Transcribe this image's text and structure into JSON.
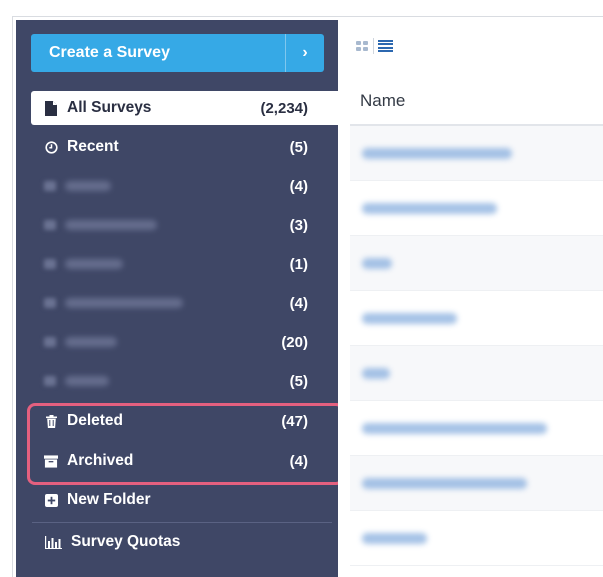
{
  "sidebar": {
    "create_button": {
      "label": "Create a Survey",
      "arrow": "›"
    },
    "all_surveys": {
      "label": "All Surveys",
      "count": "(2,234)",
      "icon": "file-icon"
    },
    "recent": {
      "label": "Recent",
      "count": "(5)",
      "icon": "clock-icon"
    },
    "folders": [
      {
        "count": "(4)"
      },
      {
        "count": "(3)"
      },
      {
        "count": "(1)"
      },
      {
        "count": "(4)"
      },
      {
        "count": "(20)"
      },
      {
        "count": "(5)"
      }
    ],
    "deleted": {
      "label": "Deleted",
      "count": "(47)",
      "icon": "trash-icon"
    },
    "archived": {
      "label": "Archived",
      "count": "(4)",
      "icon": "archive-box-icon"
    },
    "new_folder": {
      "label": "New Folder",
      "icon": "plus-square-icon"
    },
    "survey_quotas": {
      "label": "Survey Quotas",
      "icon": "bar-chart-icon"
    }
  },
  "main": {
    "view_toggle": {
      "grid_icon": "grid-view-icon",
      "list_icon": "list-view-icon",
      "active": "list"
    },
    "column_header": "Name"
  },
  "colors": {
    "sidebar_bg": "#3f4766",
    "accent_blue": "#36a9e6",
    "highlight": "#e4607f"
  }
}
